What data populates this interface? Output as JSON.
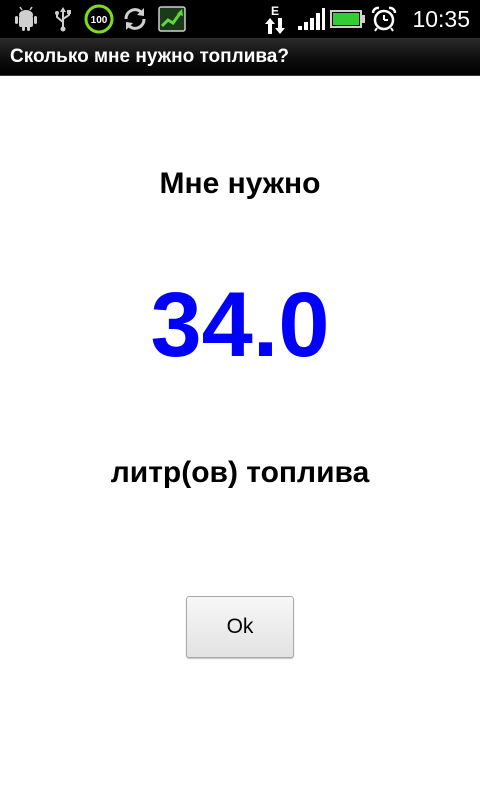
{
  "status_bar": {
    "time": "10:35",
    "battery_badge": "100",
    "network_type": "E",
    "icons": [
      "android-debug-icon",
      "usb-icon",
      "battery-100-badge-icon",
      "sync-icon",
      "stock-chart-icon",
      "data-transfer-icon",
      "signal-icon",
      "battery-icon",
      "alarm-clock-icon"
    ],
    "colors": {
      "background": "#000000",
      "battery_fill": "#33cc33",
      "badge_ring": "#7ddc1f"
    }
  },
  "app": {
    "title": "Сколько мне нужно топлива?"
  },
  "result": {
    "label": "Мне нужно",
    "amount": "34.0",
    "unit": "литр(ов) топлива",
    "amount_color": "#0000ff"
  },
  "actions": {
    "ok_label": "Ok"
  }
}
